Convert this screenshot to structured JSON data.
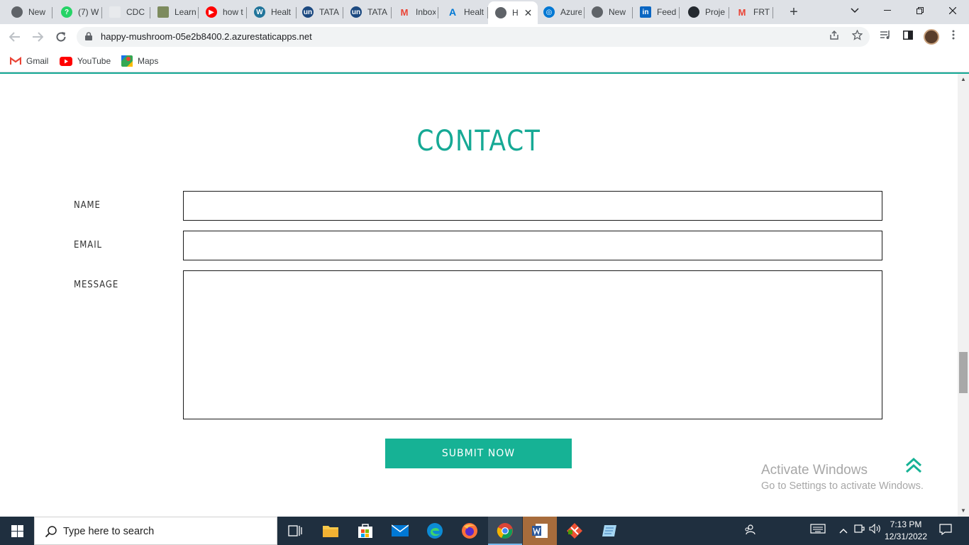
{
  "browser": {
    "tabs": [
      {
        "label": "New",
        "icon": "chrome-icon",
        "color": "#5f6368"
      },
      {
        "label": "(7) W",
        "icon": "whatsapp-icon",
        "color": "#25d366"
      },
      {
        "label": "CDC",
        "icon": "cdc-icon",
        "color": "#e8eaed"
      },
      {
        "label": "Learn",
        "icon": "learn-icon",
        "color": "#7d8b5e"
      },
      {
        "label": "how t",
        "icon": "youtube-icon",
        "color": "#ff0000"
      },
      {
        "label": "Healt",
        "icon": "wordpress-icon",
        "color": "#21759b"
      },
      {
        "label": "TATA",
        "icon": "unstop-icon",
        "color": "#1c4980"
      },
      {
        "label": "TATA",
        "icon": "unstop-icon",
        "color": "#1c4980"
      },
      {
        "label": "Inbox",
        "icon": "gmail-icon",
        "color": "#ea4335"
      },
      {
        "label": "Healt",
        "icon": "azure-icon",
        "color": "#0078d4"
      },
      {
        "label": "H",
        "icon": "globe-icon",
        "color": "#5f6368",
        "active": true
      },
      {
        "label": "Azure",
        "icon": "azure-static-icon",
        "color": "#0078d4"
      },
      {
        "label": "New",
        "icon": "chrome-icon",
        "color": "#5f6368"
      },
      {
        "label": "Feed",
        "icon": "linkedin-icon",
        "color": "#0a66c2"
      },
      {
        "label": "Proje",
        "icon": "github-icon",
        "color": "#24292f"
      },
      {
        "label": "FRT P",
        "icon": "gmail-icon",
        "color": "#ea4335"
      }
    ],
    "url": "happy-mushroom-05e2b8400.2.azurestaticapps.net",
    "bookmarks": [
      {
        "label": "Gmail",
        "icon": "gmail-icon"
      },
      {
        "label": "YouTube",
        "icon": "youtube-icon"
      },
      {
        "label": "Maps",
        "icon": "maps-icon"
      }
    ]
  },
  "page": {
    "title": "CONTACT",
    "form": {
      "name_label": "NAME",
      "email_label": "EMAIL",
      "message_label": "MESSAGE",
      "name_value": "",
      "email_value": "",
      "message_value": "",
      "submit_label": "SUBMIT NOW"
    },
    "accent_color": "#16a995"
  },
  "watermark": {
    "title": "Activate Windows",
    "subtitle": "Go to Settings to activate Windows."
  },
  "taskbar": {
    "search_placeholder": "Type here to search",
    "time": "7:13 PM",
    "date": "12/31/2022"
  }
}
